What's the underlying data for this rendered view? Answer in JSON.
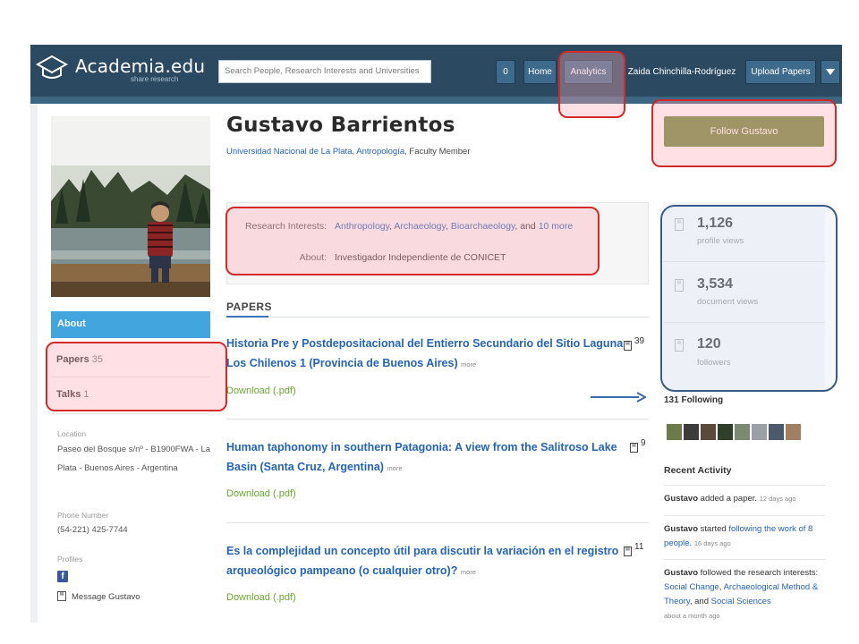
{
  "header": {
    "logo": "Academia.edu",
    "tagline": "share research",
    "search_placeholder": "Search People, Research Interests and Universities",
    "notif_count": "0",
    "nav": [
      "Home",
      "Analytics",
      "Zaida Chinchilla-Rodríguez",
      "Upload Papers"
    ],
    "colors": {
      "bar": "#2b4a62",
      "button": "#3e6a8c"
    }
  },
  "profile": {
    "name": "Gustavo Barrientos",
    "affiliation": {
      "university": "Universidad Nacional de La Plata",
      "department": "Antropología",
      "role": "Faculty Member"
    },
    "research_interests_label": "Research Interests:",
    "research_interests": [
      "Anthropology",
      "Archaeology",
      "Bioarchaeology"
    ],
    "interests_and": ", and",
    "interests_more": "10 more",
    "about_label": "About:",
    "about": "Investigador Independiente de CONICET",
    "follow_button": "Follow Gustavo"
  },
  "sidebar": {
    "tabs": [
      {
        "label": "About",
        "count": ""
      },
      {
        "label": "Papers",
        "count": "35"
      },
      {
        "label": "Talks",
        "count": "1"
      }
    ],
    "location_label": "Location",
    "location": "Paseo del Bosque s/nº - B1900FWA - La Plata - Buenos Aires - Argentina",
    "phone_label": "Phone Number",
    "phone": "(54-221) 425-7744",
    "profiles_label": "Profiles",
    "message": "Message Gustavo"
  },
  "papers": {
    "section_title": "PAPERS",
    "more_label": "more",
    "download_label": "Download (.pdf)",
    "items": [
      {
        "title": "Historia Pre y Postdepositacional del Entierro Secundario del Sitio Laguna Los Chilenos 1 (Provincia de Buenos Aires)",
        "count": "39"
      },
      {
        "title": "Human taphonomy in southern Patagonia: A view from the Salitroso Lake Basin (Santa Cruz, Argentina)",
        "count": "9"
      },
      {
        "title": "Es la complejidad un concepto útil para discutir la variación en el registro arqueológico pampeano (o cualquier otro)?",
        "count": "11"
      }
    ]
  },
  "stats": [
    {
      "value": "1,126",
      "label": "profile views"
    },
    {
      "value": "3,534",
      "label": "document views"
    },
    {
      "value": "120",
      "label": "followers"
    }
  ],
  "following_label": "131 Following",
  "recent": {
    "title": "Recent Activity",
    "items": [
      {
        "who": "Gustavo",
        "text": " added a paper. ",
        "time": "12 days ago"
      },
      {
        "who": "Gustavo",
        "text": " started ",
        "link": "following the work of 8 people.",
        "time": "16 days ago"
      },
      {
        "who": "Gustavo",
        "text": " followed the research interests: ",
        "link1": "Social Change",
        "sep1": ", ",
        "link2": "Archaeological Method & Theory",
        "sep2": ", and ",
        "link3": "Social Sciences",
        "time": "about a month ago"
      }
    ]
  }
}
